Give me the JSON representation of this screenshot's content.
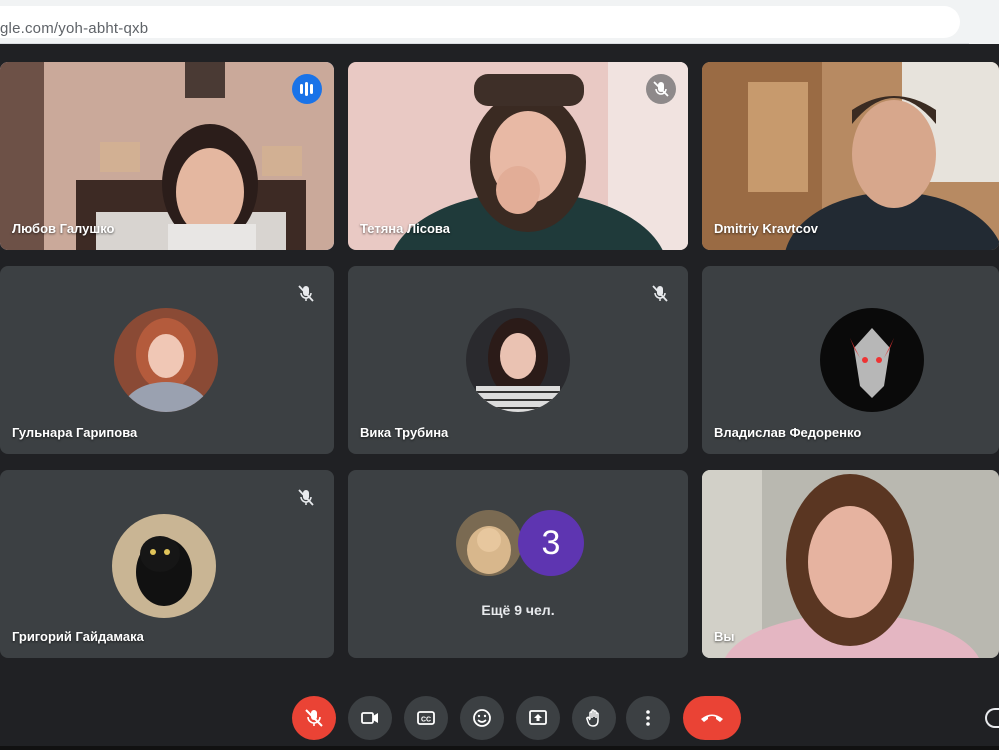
{
  "browser": {
    "url_prefix": "gle.com/",
    "url_path": "yoh-abht-qxb"
  },
  "tiles": [
    {
      "name": "Любов Галушко",
      "status": "speaking"
    },
    {
      "name": "Тетяна Лісова",
      "status": "muted"
    },
    {
      "name": "Dmitriy Kravtcov",
      "status": ""
    },
    {
      "name": "Гульнара Гарипова",
      "status": "muted"
    },
    {
      "name": "Вика Трубина",
      "status": "muted"
    },
    {
      "name": "Владислав Федоренко",
      "status": ""
    },
    {
      "name": "Григорий Гайдамака",
      "status": "muted"
    },
    {
      "name": "Вы",
      "status": ""
    }
  ],
  "more_participants": {
    "count_badge": "3",
    "label": "Ещё 9 чел."
  },
  "colors": {
    "background": "#202124",
    "tile": "#3c4043",
    "accent_blue": "#1a73e8",
    "active_border": "#8ab4f8",
    "danger_red": "#ea4335",
    "count_purple": "#5e35b1"
  },
  "controls": [
    {
      "icon": "mic-off-icon"
    },
    {
      "icon": "camera-icon"
    },
    {
      "icon": "captions-icon"
    },
    {
      "icon": "emoji-icon"
    },
    {
      "icon": "present-screen-icon"
    },
    {
      "icon": "raise-hand-icon"
    },
    {
      "icon": "more-options-icon"
    },
    {
      "icon": "hang-up-icon"
    }
  ]
}
